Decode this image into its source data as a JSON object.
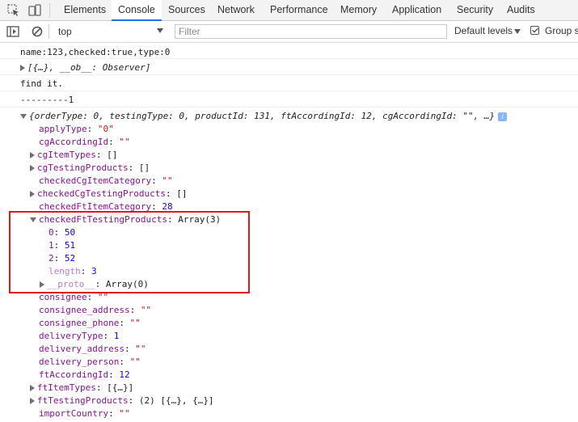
{
  "tabs": [
    "Elements",
    "Console",
    "Sources",
    "Network",
    "Performance",
    "Memory",
    "Application",
    "Security",
    "Audits"
  ],
  "active_tab": "Console",
  "toolbar": {
    "context": "top",
    "filter_placeholder": "Filter",
    "levels": "Default levels",
    "group_label": "Group s"
  },
  "console": {
    "line1": "name:123,checked:true,type:0",
    "line2_obj": "[{…}, __ob__: Observer]",
    "line3": "find it.",
    "line4": "---------1",
    "obj_summary": "{orderType: 0, testingType: 0, productId: 131, ftAccordingId: 12, cgAccordingId: \"\", …}",
    "badge": "i",
    "props": [
      {
        "key": "applyType",
        "sep": ": ",
        "val": "\"0\""
      },
      {
        "key": "cgAccordingId",
        "sep": ": ",
        "val": "\"\""
      },
      {
        "key": "cgItemTypes",
        "sep": ": ",
        "val": "[]"
      },
      {
        "key": "cgTestingProducts",
        "sep": ": ",
        "val": "[]"
      },
      {
        "key": "checkedCgItemCategory",
        "sep": ": ",
        "val": "\"\""
      },
      {
        "key": "checkedCgTestingProducts",
        "sep": ": ",
        "val": "[]"
      },
      {
        "key": "checkedFtItemCategory",
        "sep": ": ",
        "val": "28"
      },
      {
        "key": "checkedFtTestingProducts",
        "sep": ": ",
        "val": "Array(3)"
      },
      {
        "key": "0",
        "sep": ": ",
        "val": "50"
      },
      {
        "key": "1",
        "sep": ": ",
        "val": "51"
      },
      {
        "key": "2",
        "sep": ": ",
        "val": "52"
      },
      {
        "key": "length",
        "sep": ": ",
        "val": "3"
      },
      {
        "key": "__proto__",
        "sep": ": ",
        "val": "Array(0)"
      },
      {
        "key": "consignee",
        "sep": ": ",
        "val": "\"\""
      },
      {
        "key": "consignee_address",
        "sep": ": ",
        "val": "\"\""
      },
      {
        "key": "consignee_phone",
        "sep": ": ",
        "val": "\"\""
      },
      {
        "key": "deliveryType",
        "sep": ": ",
        "val": "1"
      },
      {
        "key": "delivery_address",
        "sep": ": ",
        "val": "\"\""
      },
      {
        "key": "delivery_person",
        "sep": ": ",
        "val": "\"\""
      },
      {
        "key": "ftAccordingId",
        "sep": ": ",
        "val": "12"
      },
      {
        "key": "ftItemTypes",
        "sep": ": ",
        "val": "[{…}]"
      },
      {
        "key": "ftTestingProducts",
        "sep": ": ",
        "val": "(2) [{…}, {…}]"
      },
      {
        "key": "importCountry",
        "sep": ": ",
        "val": "\"\""
      }
    ]
  }
}
